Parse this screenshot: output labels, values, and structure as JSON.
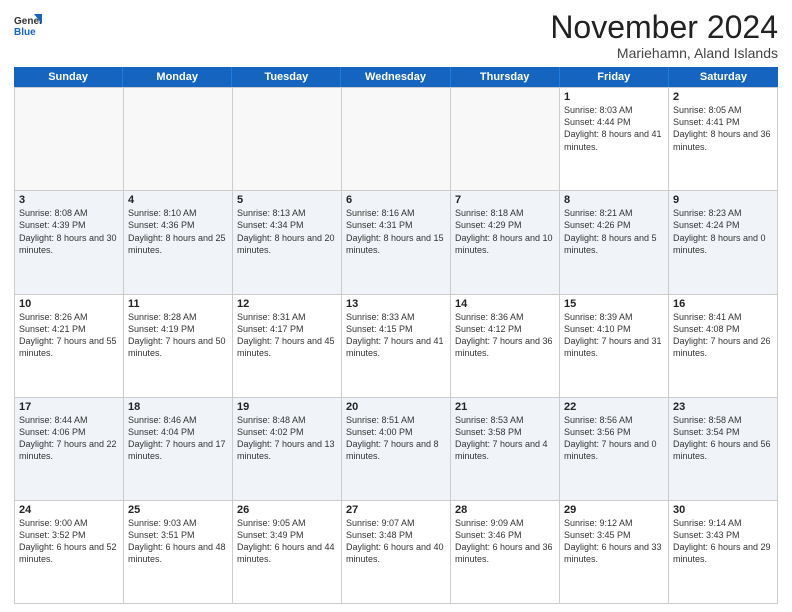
{
  "logo": {
    "general": "General",
    "blue": "Blue"
  },
  "header": {
    "month": "November 2024",
    "location": "Mariehamn, Aland Islands"
  },
  "weekdays": [
    "Sunday",
    "Monday",
    "Tuesday",
    "Wednesday",
    "Thursday",
    "Friday",
    "Saturday"
  ],
  "weeks": [
    [
      {
        "day": "",
        "info": "",
        "empty": true
      },
      {
        "day": "",
        "info": "",
        "empty": true
      },
      {
        "day": "",
        "info": "",
        "empty": true
      },
      {
        "day": "",
        "info": "",
        "empty": true
      },
      {
        "day": "",
        "info": "",
        "empty": true
      },
      {
        "day": "1",
        "info": "Sunrise: 8:03 AM\nSunset: 4:44 PM\nDaylight: 8 hours and 41 minutes.",
        "empty": false
      },
      {
        "day": "2",
        "info": "Sunrise: 8:05 AM\nSunset: 4:41 PM\nDaylight: 8 hours and 36 minutes.",
        "empty": false
      }
    ],
    [
      {
        "day": "3",
        "info": "Sunrise: 8:08 AM\nSunset: 4:39 PM\nDaylight: 8 hours and 30 minutes.",
        "empty": false
      },
      {
        "day": "4",
        "info": "Sunrise: 8:10 AM\nSunset: 4:36 PM\nDaylight: 8 hours and 25 minutes.",
        "empty": false
      },
      {
        "day": "5",
        "info": "Sunrise: 8:13 AM\nSunset: 4:34 PM\nDaylight: 8 hours and 20 minutes.",
        "empty": false
      },
      {
        "day": "6",
        "info": "Sunrise: 8:16 AM\nSunset: 4:31 PM\nDaylight: 8 hours and 15 minutes.",
        "empty": false
      },
      {
        "day": "7",
        "info": "Sunrise: 8:18 AM\nSunset: 4:29 PM\nDaylight: 8 hours and 10 minutes.",
        "empty": false
      },
      {
        "day": "8",
        "info": "Sunrise: 8:21 AM\nSunset: 4:26 PM\nDaylight: 8 hours and 5 minutes.",
        "empty": false
      },
      {
        "day": "9",
        "info": "Sunrise: 8:23 AM\nSunset: 4:24 PM\nDaylight: 8 hours and 0 minutes.",
        "empty": false
      }
    ],
    [
      {
        "day": "10",
        "info": "Sunrise: 8:26 AM\nSunset: 4:21 PM\nDaylight: 7 hours and 55 minutes.",
        "empty": false
      },
      {
        "day": "11",
        "info": "Sunrise: 8:28 AM\nSunset: 4:19 PM\nDaylight: 7 hours and 50 minutes.",
        "empty": false
      },
      {
        "day": "12",
        "info": "Sunrise: 8:31 AM\nSunset: 4:17 PM\nDaylight: 7 hours and 45 minutes.",
        "empty": false
      },
      {
        "day": "13",
        "info": "Sunrise: 8:33 AM\nSunset: 4:15 PM\nDaylight: 7 hours and 41 minutes.",
        "empty": false
      },
      {
        "day": "14",
        "info": "Sunrise: 8:36 AM\nSunset: 4:12 PM\nDaylight: 7 hours and 36 minutes.",
        "empty": false
      },
      {
        "day": "15",
        "info": "Sunrise: 8:39 AM\nSunset: 4:10 PM\nDaylight: 7 hours and 31 minutes.",
        "empty": false
      },
      {
        "day": "16",
        "info": "Sunrise: 8:41 AM\nSunset: 4:08 PM\nDaylight: 7 hours and 26 minutes.",
        "empty": false
      }
    ],
    [
      {
        "day": "17",
        "info": "Sunrise: 8:44 AM\nSunset: 4:06 PM\nDaylight: 7 hours and 22 minutes.",
        "empty": false
      },
      {
        "day": "18",
        "info": "Sunrise: 8:46 AM\nSunset: 4:04 PM\nDaylight: 7 hours and 17 minutes.",
        "empty": false
      },
      {
        "day": "19",
        "info": "Sunrise: 8:48 AM\nSunset: 4:02 PM\nDaylight: 7 hours and 13 minutes.",
        "empty": false
      },
      {
        "day": "20",
        "info": "Sunrise: 8:51 AM\nSunset: 4:00 PM\nDaylight: 7 hours and 8 minutes.",
        "empty": false
      },
      {
        "day": "21",
        "info": "Sunrise: 8:53 AM\nSunset: 3:58 PM\nDaylight: 7 hours and 4 minutes.",
        "empty": false
      },
      {
        "day": "22",
        "info": "Sunrise: 8:56 AM\nSunset: 3:56 PM\nDaylight: 7 hours and 0 minutes.",
        "empty": false
      },
      {
        "day": "23",
        "info": "Sunrise: 8:58 AM\nSunset: 3:54 PM\nDaylight: 6 hours and 56 minutes.",
        "empty": false
      }
    ],
    [
      {
        "day": "24",
        "info": "Sunrise: 9:00 AM\nSunset: 3:52 PM\nDaylight: 6 hours and 52 minutes.",
        "empty": false
      },
      {
        "day": "25",
        "info": "Sunrise: 9:03 AM\nSunset: 3:51 PM\nDaylight: 6 hours and 48 minutes.",
        "empty": false
      },
      {
        "day": "26",
        "info": "Sunrise: 9:05 AM\nSunset: 3:49 PM\nDaylight: 6 hours and 44 minutes.",
        "empty": false
      },
      {
        "day": "27",
        "info": "Sunrise: 9:07 AM\nSunset: 3:48 PM\nDaylight: 6 hours and 40 minutes.",
        "empty": false
      },
      {
        "day": "28",
        "info": "Sunrise: 9:09 AM\nSunset: 3:46 PM\nDaylight: 6 hours and 36 minutes.",
        "empty": false
      },
      {
        "day": "29",
        "info": "Sunrise: 9:12 AM\nSunset: 3:45 PM\nDaylight: 6 hours and 33 minutes.",
        "empty": false
      },
      {
        "day": "30",
        "info": "Sunrise: 9:14 AM\nSunset: 3:43 PM\nDaylight: 6 hours and 29 minutes.",
        "empty": false
      }
    ]
  ],
  "alt_rows": [
    1,
    3
  ]
}
